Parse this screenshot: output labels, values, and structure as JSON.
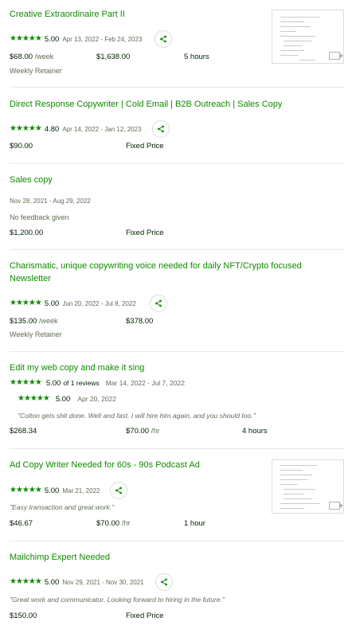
{
  "jobs": [
    {
      "title": "Creative Extraordinaire Part II",
      "rating": "5.00",
      "dates": "Apr 13, 2022 - Feb 24, 2023",
      "rate": "$68.00",
      "rate_unit": "/week",
      "earned": "$1,638.00",
      "hours": "5 hours",
      "type": "Weekly Retainer"
    },
    {
      "title": "Direct Response Copywriter | Cold Email | B2B Outreach | Sales Copy",
      "rating": "4.80",
      "dates": "Apr 14, 2022 - Jan 12, 2023",
      "earned": "$90.00",
      "type": "Fixed Price"
    },
    {
      "title": "Sales copy",
      "dates": "Nov 28, 2021 - Aug 29, 2022",
      "feedback": "No feedback given",
      "earned": "$1,200.00",
      "type": "Fixed Price"
    },
    {
      "title_line1": "Charismatic, unique copywriting voice needed for daily NFT/Crypto focused",
      "title_line2": "Newsletter",
      "rating": "5.00",
      "dates": "Jun 20, 2022 - Jul 8, 2022",
      "rate": "$135.00",
      "rate_unit": "/week",
      "earned": "$378.00",
      "type": "Weekly Retainer"
    },
    {
      "title": "Edit my web copy and make it sing",
      "rating": "5.00",
      "reviews": "of 1 reviews",
      "dates": "Mar 14, 2022 - Jul 7, 2022",
      "review_rating": "5.00",
      "review_date": "Apr 20, 2022",
      "quote": "\"Colton gets shit done. Well and fast. I will hire him again, and you should too.\"",
      "earned": "$268.34",
      "rate": "$70.00",
      "rate_unit": "/hr",
      "hours": "4 hours"
    },
    {
      "title": "Ad Copy Writer Needed for 60s - 90s Podcast Ad",
      "rating": "5.00",
      "dates": "Mar 21, 2022",
      "quote": "\"Easy transaction and great work.\"",
      "earned": "$46.67",
      "rate": "$70.00",
      "rate_unit": "/hr",
      "hours": "1 hour"
    },
    {
      "title": "Mailchimp Expert Needed",
      "rating": "5.00",
      "dates": "Nov 29, 2021 - Nov 30, 2021",
      "quote": "\"Great work and communicator. Looking forward to hiring in the future.\"",
      "earned": "$150.00",
      "type": "Fixed Price"
    }
  ],
  "stars": "★★★★★",
  "colors": {
    "accent": "#108a00",
    "text": "#001e00",
    "muted": "#5e6d55",
    "divider": "#e4ebe4"
  },
  "icons": {
    "share": "share-icon",
    "star": "star-icon",
    "video": "video-camera-icon"
  }
}
